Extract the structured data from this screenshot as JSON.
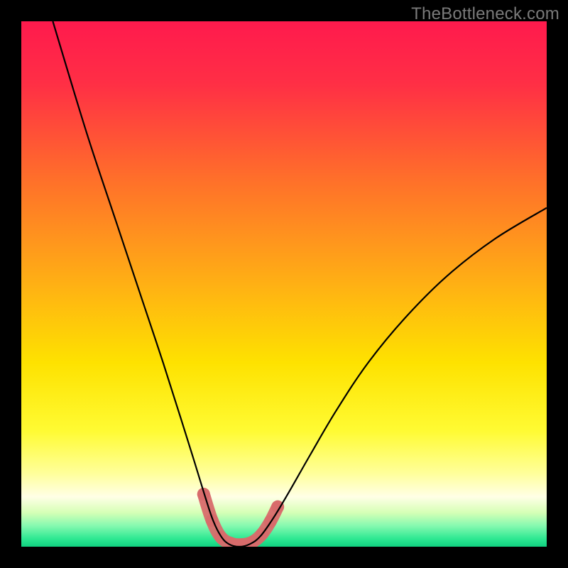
{
  "watermark": "TheBottleneck.com",
  "chart_data": {
    "type": "line",
    "title": "",
    "xlabel": "",
    "ylabel": "",
    "xlim": [
      0,
      100
    ],
    "ylim": [
      0,
      100
    ],
    "gradient_stops": [
      {
        "pos": 0.0,
        "color": "#ff1a4d"
      },
      {
        "pos": 0.12,
        "color": "#ff2f45"
      },
      {
        "pos": 0.3,
        "color": "#ff6f2a"
      },
      {
        "pos": 0.5,
        "color": "#ffb014"
      },
      {
        "pos": 0.65,
        "color": "#fee200"
      },
      {
        "pos": 0.78,
        "color": "#fffb33"
      },
      {
        "pos": 0.86,
        "color": "#ffff9a"
      },
      {
        "pos": 0.905,
        "color": "#ffffe6"
      },
      {
        "pos": 0.935,
        "color": "#d6ffb6"
      },
      {
        "pos": 0.96,
        "color": "#86f9b0"
      },
      {
        "pos": 0.985,
        "color": "#2de892"
      },
      {
        "pos": 1.0,
        "color": "#10d080"
      }
    ],
    "series": [
      {
        "name": "bottleneck-curve",
        "stroke": "#000000",
        "stroke_width": 2.2,
        "points": [
          {
            "x": 6.0,
            "y": 100.0
          },
          {
            "x": 9.0,
            "y": 90.0
          },
          {
            "x": 13.0,
            "y": 77.0
          },
          {
            "x": 18.0,
            "y": 62.0
          },
          {
            "x": 23.0,
            "y": 47.0
          },
          {
            "x": 27.0,
            "y": 35.0
          },
          {
            "x": 30.5,
            "y": 24.0
          },
          {
            "x": 33.0,
            "y": 16.0
          },
          {
            "x": 35.0,
            "y": 9.5
          },
          {
            "x": 36.5,
            "y": 5.0
          },
          {
            "x": 38.0,
            "y": 2.0
          },
          {
            "x": 39.5,
            "y": 0.5
          },
          {
            "x": 41.5,
            "y": 0.0
          },
          {
            "x": 43.5,
            "y": 0.5
          },
          {
            "x": 45.5,
            "y": 2.0
          },
          {
            "x": 48.0,
            "y": 5.5
          },
          {
            "x": 51.0,
            "y": 10.5
          },
          {
            "x": 55.0,
            "y": 17.5
          },
          {
            "x": 60.0,
            "y": 26.0
          },
          {
            "x": 66.0,
            "y": 35.0
          },
          {
            "x": 73.0,
            "y": 43.5
          },
          {
            "x": 81.0,
            "y": 51.5
          },
          {
            "x": 90.0,
            "y": 58.5
          },
          {
            "x": 100.0,
            "y": 64.5
          }
        ]
      },
      {
        "name": "highlight-band",
        "stroke": "#d86b6b",
        "stroke_width": 18,
        "linecap": "round",
        "points": [
          {
            "x": 34.7,
            "y": 10.0
          },
          {
            "x": 36.3,
            "y": 5.0
          },
          {
            "x": 38.0,
            "y": 1.8
          },
          {
            "x": 40.0,
            "y": 0.6
          },
          {
            "x": 42.0,
            "y": 0.4
          },
          {
            "x": 44.0,
            "y": 0.9
          },
          {
            "x": 45.8,
            "y": 2.4
          },
          {
            "x": 47.4,
            "y": 4.8
          },
          {
            "x": 48.8,
            "y": 7.6
          }
        ]
      }
    ],
    "highlight_dots": {
      "color": "#d86b6b",
      "radius": 9,
      "points": [
        {
          "x": 34.7,
          "y": 10.0
        },
        {
          "x": 36.3,
          "y": 5.0
        },
        {
          "x": 38.0,
          "y": 1.8
        },
        {
          "x": 40.0,
          "y": 0.6
        },
        {
          "x": 42.0,
          "y": 0.4
        },
        {
          "x": 44.0,
          "y": 0.9
        },
        {
          "x": 45.8,
          "y": 2.4
        },
        {
          "x": 47.4,
          "y": 4.8
        },
        {
          "x": 48.8,
          "y": 7.6
        }
      ]
    }
  }
}
